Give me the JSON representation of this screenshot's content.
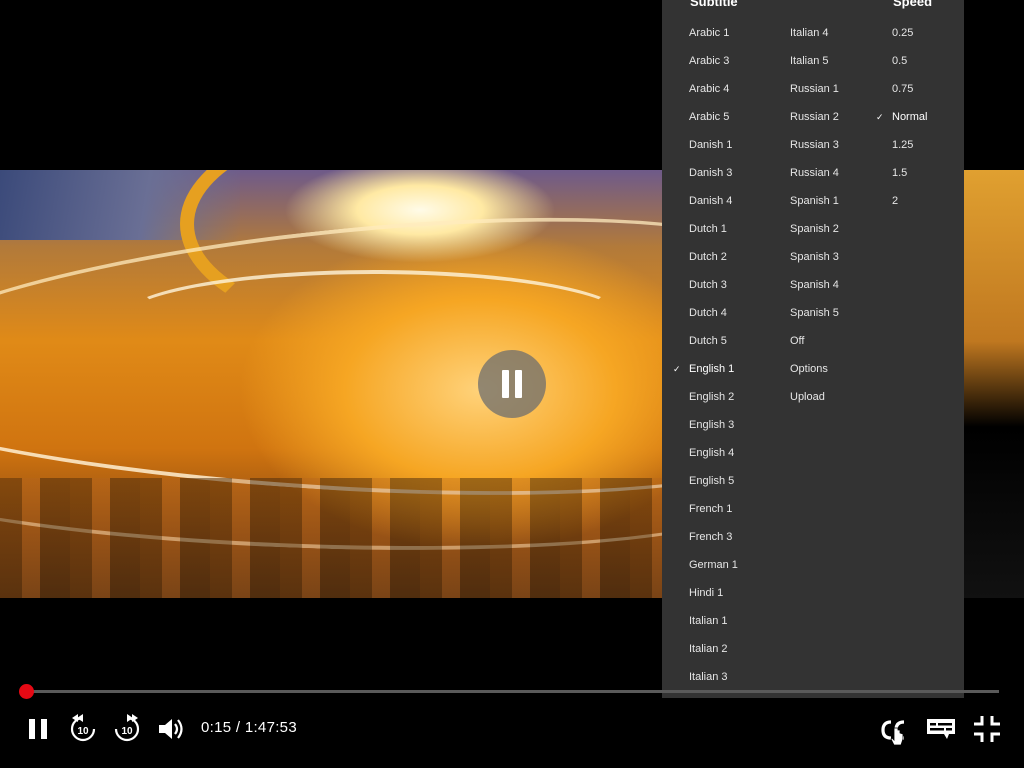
{
  "player": {
    "current_time": "0:15",
    "time_separator": " / ",
    "duration": "1:47:53",
    "progress": 0.0023,
    "state": "playing",
    "accent_color": "#e50914"
  },
  "controls": {
    "skip_back_seconds": "10",
    "skip_forward_seconds": "10"
  },
  "menu": {
    "subtitle_header": "Subtitle",
    "speed_header": "Speed",
    "subtitle_col1": [
      {
        "label": "Arabic 1"
      },
      {
        "label": "Arabic 3"
      },
      {
        "label": "Arabic 4"
      },
      {
        "label": "Arabic 5"
      },
      {
        "label": "Danish 1"
      },
      {
        "label": "Danish 3"
      },
      {
        "label": "Danish 4"
      },
      {
        "label": "Dutch 1"
      },
      {
        "label": "Dutch 2"
      },
      {
        "label": "Dutch 3"
      },
      {
        "label": "Dutch 4"
      },
      {
        "label": "Dutch 5"
      },
      {
        "label": "English 1",
        "selected": true
      },
      {
        "label": "English 2"
      },
      {
        "label": "English 3"
      },
      {
        "label": "English 4"
      },
      {
        "label": "English 5"
      },
      {
        "label": "French 1"
      },
      {
        "label": "French 3"
      },
      {
        "label": "German 1"
      },
      {
        "label": "Hindi 1"
      },
      {
        "label": "Italian 1"
      },
      {
        "label": "Italian 2"
      },
      {
        "label": "Italian 3"
      }
    ],
    "subtitle_col2": [
      {
        "label": "Italian 4"
      },
      {
        "label": "Italian 5"
      },
      {
        "label": "Russian 1"
      },
      {
        "label": "Russian 2"
      },
      {
        "label": "Russian 3"
      },
      {
        "label": "Russian 4"
      },
      {
        "label": "Spanish 1"
      },
      {
        "label": "Spanish 2"
      },
      {
        "label": "Spanish 3"
      },
      {
        "label": "Spanish 4"
      },
      {
        "label": "Spanish 5"
      },
      {
        "label": "Off"
      },
      {
        "label": "Options"
      },
      {
        "label": "Upload"
      }
    ],
    "speed_options": [
      {
        "label": "0.25"
      },
      {
        "label": "0.5"
      },
      {
        "label": "0.75"
      },
      {
        "label": "Normal",
        "selected": true
      },
      {
        "label": "1.25"
      },
      {
        "label": "1.5"
      },
      {
        "label": "2"
      }
    ],
    "check_glyph": "✓"
  },
  "icons": {
    "pause": "pause-icon",
    "rewind": "rewind-10-icon",
    "forward": "forward-10-icon",
    "volume": "volume-icon",
    "captions": "closed-captions-icon",
    "subtitles": "subtitles-icon",
    "exit_fullscreen": "exit-fullscreen-icon"
  }
}
